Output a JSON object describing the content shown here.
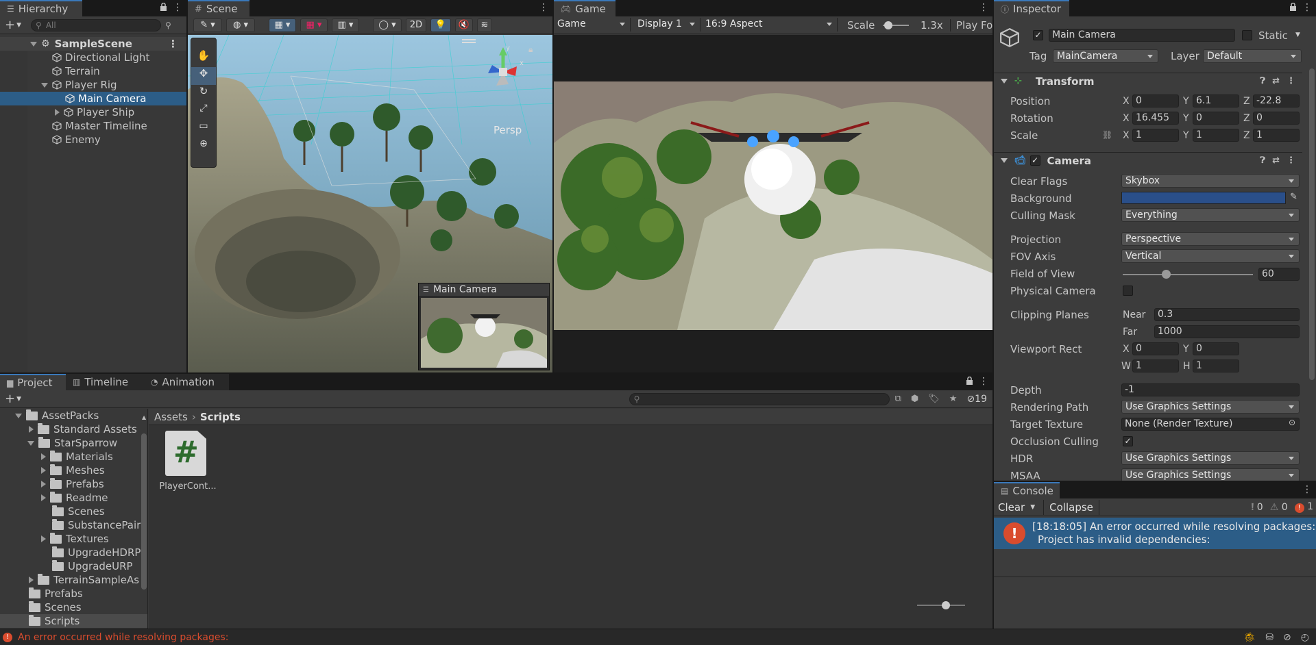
{
  "colors": {
    "accent": "#3a79bb",
    "selection": "#2c5d87",
    "error": "#d94c2e",
    "background_color_swatch": "#2a4f8a"
  },
  "hierarchy": {
    "tab_label": "Hierarchy",
    "search_placeholder": "All",
    "items": [
      {
        "label": "SampleScene"
      },
      {
        "label": "Directional Light"
      },
      {
        "label": "Terrain"
      },
      {
        "label": "Player Rig"
      },
      {
        "label": "Main Camera"
      },
      {
        "label": "Player Ship"
      },
      {
        "label": "Master Timeline"
      },
      {
        "label": "Enemy"
      }
    ]
  },
  "scene": {
    "tab_label": "Scene",
    "btn_2d": "2D",
    "persp_label": "Persp",
    "gizmo_axes": {
      "y": "y",
      "x": "x"
    },
    "camera_preview_title": "Main Camera"
  },
  "game": {
    "tab_label": "Game",
    "mode": "Game",
    "display": "Display 1",
    "aspect": "16:9 Aspect",
    "scale_label": "Scale",
    "scale_value": "1.3x",
    "play_focused": "Play Foc"
  },
  "inspector": {
    "tab_label": "Inspector",
    "object_name": "Main Camera",
    "static_label": "Static",
    "tag_label": "Tag",
    "tag_value": "MainCamera",
    "layer_label": "Layer",
    "layer_value": "Default",
    "transform": {
      "title": "Transform",
      "position_label": "Position",
      "rotation_label": "Rotation",
      "scale_label": "Scale",
      "x": "X",
      "y": "Y",
      "z": "Z",
      "position": {
        "x": "0",
        "y": "6.1",
        "z": "-22.8"
      },
      "rotation": {
        "x": "16.455",
        "y": "0",
        "z": "0"
      },
      "scale": {
        "x": "1",
        "y": "1",
        "z": "1"
      }
    },
    "camera": {
      "title": "Camera",
      "clear_flags_label": "Clear Flags",
      "clear_flags": "Skybox",
      "background_label": "Background",
      "culling_mask_label": "Culling Mask",
      "culling_mask": "Everything",
      "projection_label": "Projection",
      "projection": "Perspective",
      "fov_axis_label": "FOV Axis",
      "fov_axis": "Vertical",
      "fov_label": "Field of View",
      "fov_value": "60",
      "fov_slider_fraction": 0.34,
      "physical_camera_label": "Physical Camera",
      "clipping_planes_label": "Clipping Planes",
      "near_label": "Near",
      "near": "0.3",
      "far_label": "Far",
      "far": "1000",
      "viewport_rect_label": "Viewport Rect",
      "viewport": {
        "x": "0",
        "y": "0",
        "w": "1",
        "h": "1"
      },
      "w_label": "W",
      "h_label": "H",
      "depth_label": "Depth",
      "depth": "-1",
      "rendering_path_label": "Rendering Path",
      "rendering_path": "Use Graphics Settings",
      "target_texture_label": "Target Texture",
      "target_texture": "None (Render Texture)",
      "occlusion_culling_label": "Occlusion Culling",
      "hdr_label": "HDR",
      "hdr": "Use Graphics Settings",
      "msaa_label": "MSAA",
      "msaa": "Use Graphics Settings"
    }
  },
  "project": {
    "tab_project": "Project",
    "tab_timeline": "Timeline",
    "tab_animation": "Animation",
    "hidden_count": "19",
    "breadcrumb": {
      "root": "Assets",
      "current": "Scripts"
    },
    "tree": [
      {
        "label": "AssetPacks"
      },
      {
        "label": "Standard Assets"
      },
      {
        "label": "StarSparrow"
      },
      {
        "label": "Materials"
      },
      {
        "label": "Meshes"
      },
      {
        "label": "Prefabs"
      },
      {
        "label": "Readme"
      },
      {
        "label": "Scenes"
      },
      {
        "label": "SubstancePair"
      },
      {
        "label": "Textures"
      },
      {
        "label": "UpgradeHDRP"
      },
      {
        "label": "UpgradeURP"
      },
      {
        "label": "TerrainSampleAs"
      },
      {
        "label": "Prefabs"
      },
      {
        "label": "Scenes"
      },
      {
        "label": "Scripts"
      }
    ],
    "files": [
      {
        "label": "PlayerCont...",
        "glyph": "#"
      }
    ]
  },
  "console": {
    "tab_label": "Console",
    "clear_label": "Clear",
    "collapse_label": "Collapse",
    "log_count": "0",
    "warn_count": "0",
    "error_count": "1",
    "entries": [
      {
        "line1": "[18:18:05] An error occurred while resolving packages:",
        "line2": "Project has invalid dependencies:"
      }
    ]
  },
  "status_bar": {
    "message": "An error occurred while resolving packages:"
  }
}
